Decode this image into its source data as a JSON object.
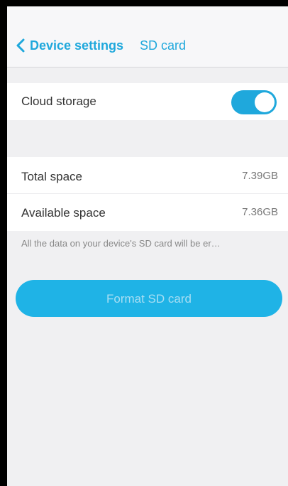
{
  "nav": {
    "back_label": "Device settings",
    "title": "SD card"
  },
  "cloud_storage": {
    "label": "Cloud storage",
    "enabled": true
  },
  "storage": {
    "total_label": "Total space",
    "total_value": "7.39GB",
    "available_label": "Available space",
    "available_value": "7.36GB"
  },
  "notice": "All the data on your device's SD card will be er…",
  "format_button_label": "Format SD card",
  "colors": {
    "accent": "#1fa8dc",
    "button": "#1fb3e6",
    "background": "#f0f0f2"
  }
}
